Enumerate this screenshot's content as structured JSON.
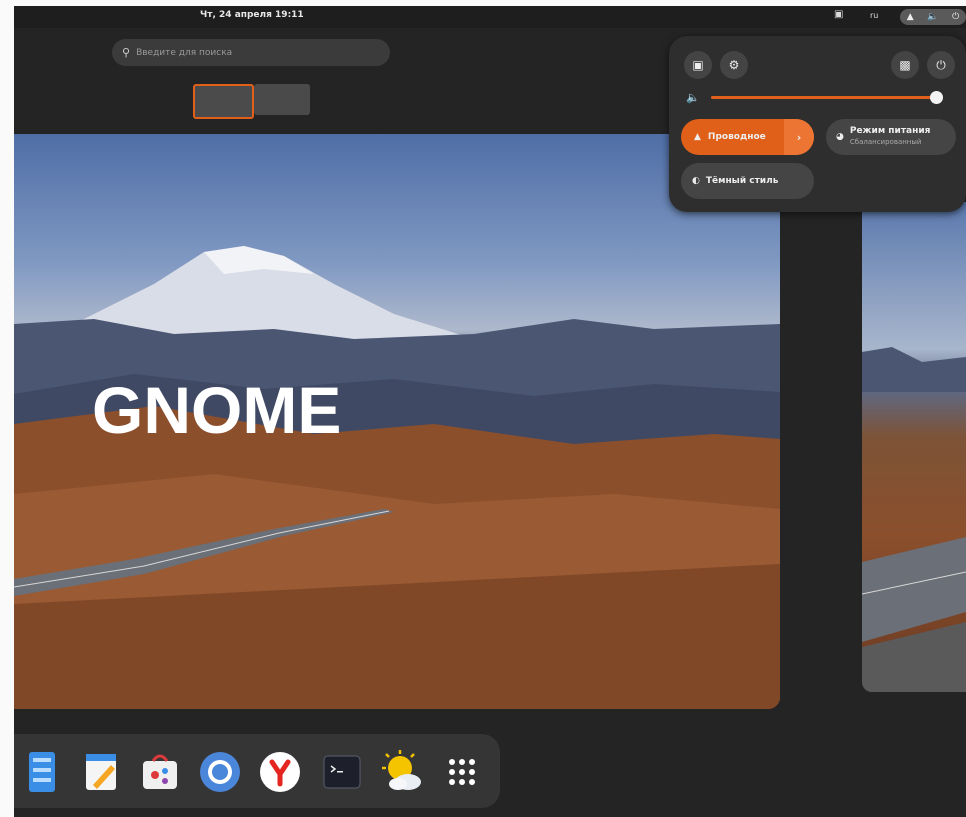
{
  "topbar": {
    "clock": "Чт, 24 апреля  19:11",
    "layout_indicator": "ru",
    "screenshot_icon": "screenshot-icon",
    "system_icons": [
      "network-wired-icon",
      "volume-icon",
      "power-icon"
    ]
  },
  "overview": {
    "search_placeholder": "Введите для поиска",
    "workspaces": [
      "workspace-1",
      "workspace-2"
    ],
    "overlay_title": "GNOME"
  },
  "quick_settings": {
    "top_buttons": [
      "screenshot-icon",
      "settings-icon",
      "lock-icon",
      "power-icon"
    ],
    "volume_level": 0.97,
    "network": {
      "label": "Проводное",
      "active": true
    },
    "power_mode": {
      "label": "Режим питания",
      "value": "Сбалансированный"
    },
    "dark_style": {
      "label": "Тёмный стиль",
      "active": false
    }
  },
  "dash": {
    "apps": [
      "files-icon",
      "text-editor-icon",
      "software-center-icon",
      "chromium-icon",
      "yandex-browser-icon",
      "terminal-icon",
      "weather-icon",
      "app-grid-icon"
    ]
  },
  "colors": {
    "accent": "#e0601a",
    "panel_bg": "#2e2e2e",
    "shell_bg": "#242424"
  }
}
